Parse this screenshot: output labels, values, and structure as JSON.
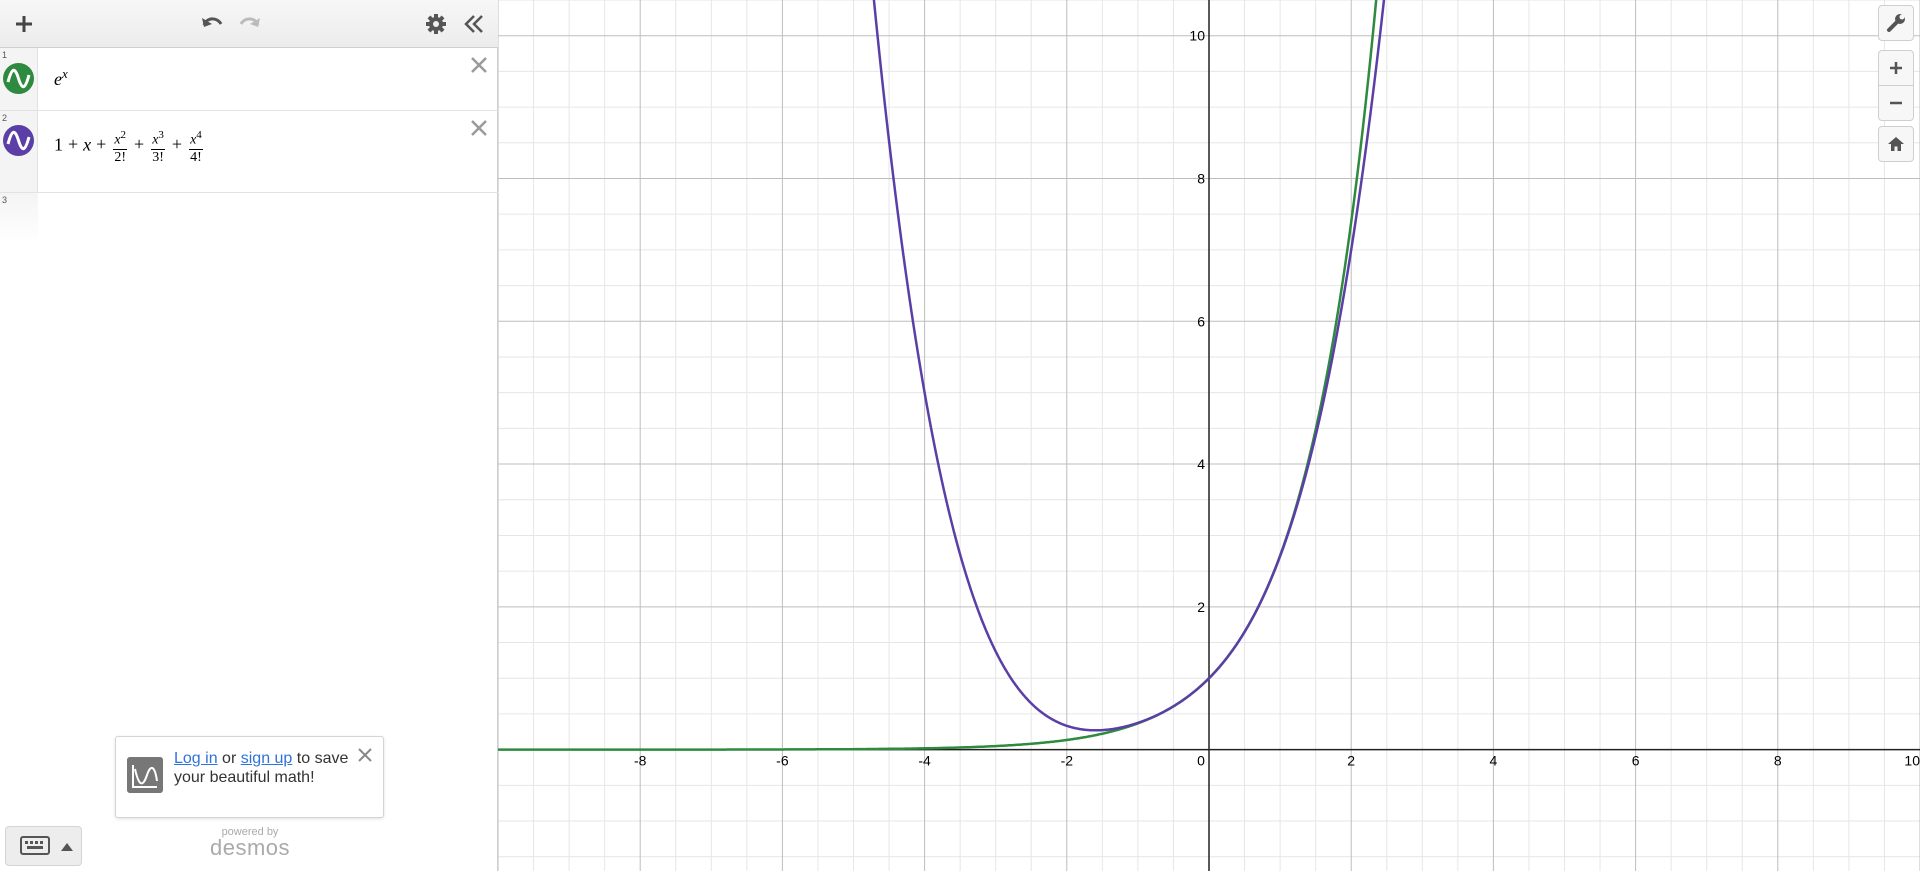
{
  "toolbar": {
    "add_icon": "plus-icon",
    "undo_icon": "undo-icon",
    "redo_icon": "redo-icon",
    "settings_icon": "gear-icon",
    "collapse_icon": "double-chevron-left-icon"
  },
  "expressions": [
    {
      "index": "1",
      "color": "#2d8a3e",
      "latex_text": "e^x",
      "base": "e",
      "exponent": "x"
    },
    {
      "index": "2",
      "color": "#5b3ea6",
      "terms": [
        "1",
        "+",
        "x",
        "+",
        "+",
        "+"
      ],
      "fractions": [
        {
          "num_base": "x",
          "num_exp": "2",
          "den": "2!"
        },
        {
          "num_base": "x",
          "num_exp": "3",
          "den": "3!"
        },
        {
          "num_base": "x",
          "num_exp": "4",
          "den": "4!"
        }
      ]
    },
    {
      "index": "3"
    }
  ],
  "toast": {
    "login_link": "Log in",
    "or_text": "or",
    "signup_link": "sign up",
    "rest_text": "to save your beautiful math!"
  },
  "powered": {
    "by": "powered by",
    "brand": "desmos"
  },
  "controls": [
    "wrench-icon",
    "zoom-in-icon",
    "zoom-out-icon",
    "home-icon"
  ],
  "chart_data": {
    "type": "line",
    "xlim": [
      -10,
      10
    ],
    "ylim": [
      -1.7,
      10.5
    ],
    "grid": true,
    "x_ticks": [
      "-8",
      "-6",
      "-4",
      "-2",
      "0",
      "2",
      "4",
      "6",
      "8",
      "10"
    ],
    "y_ticks": [
      "2",
      "4",
      "6",
      "8",
      "10"
    ],
    "series": [
      {
        "expression": "e^x",
        "color": "#2d8a3e"
      },
      {
        "expression": "1 + x + x^2/2! + x^3/3! + x^4/4!",
        "color": "#5b3ea6"
      }
    ]
  }
}
